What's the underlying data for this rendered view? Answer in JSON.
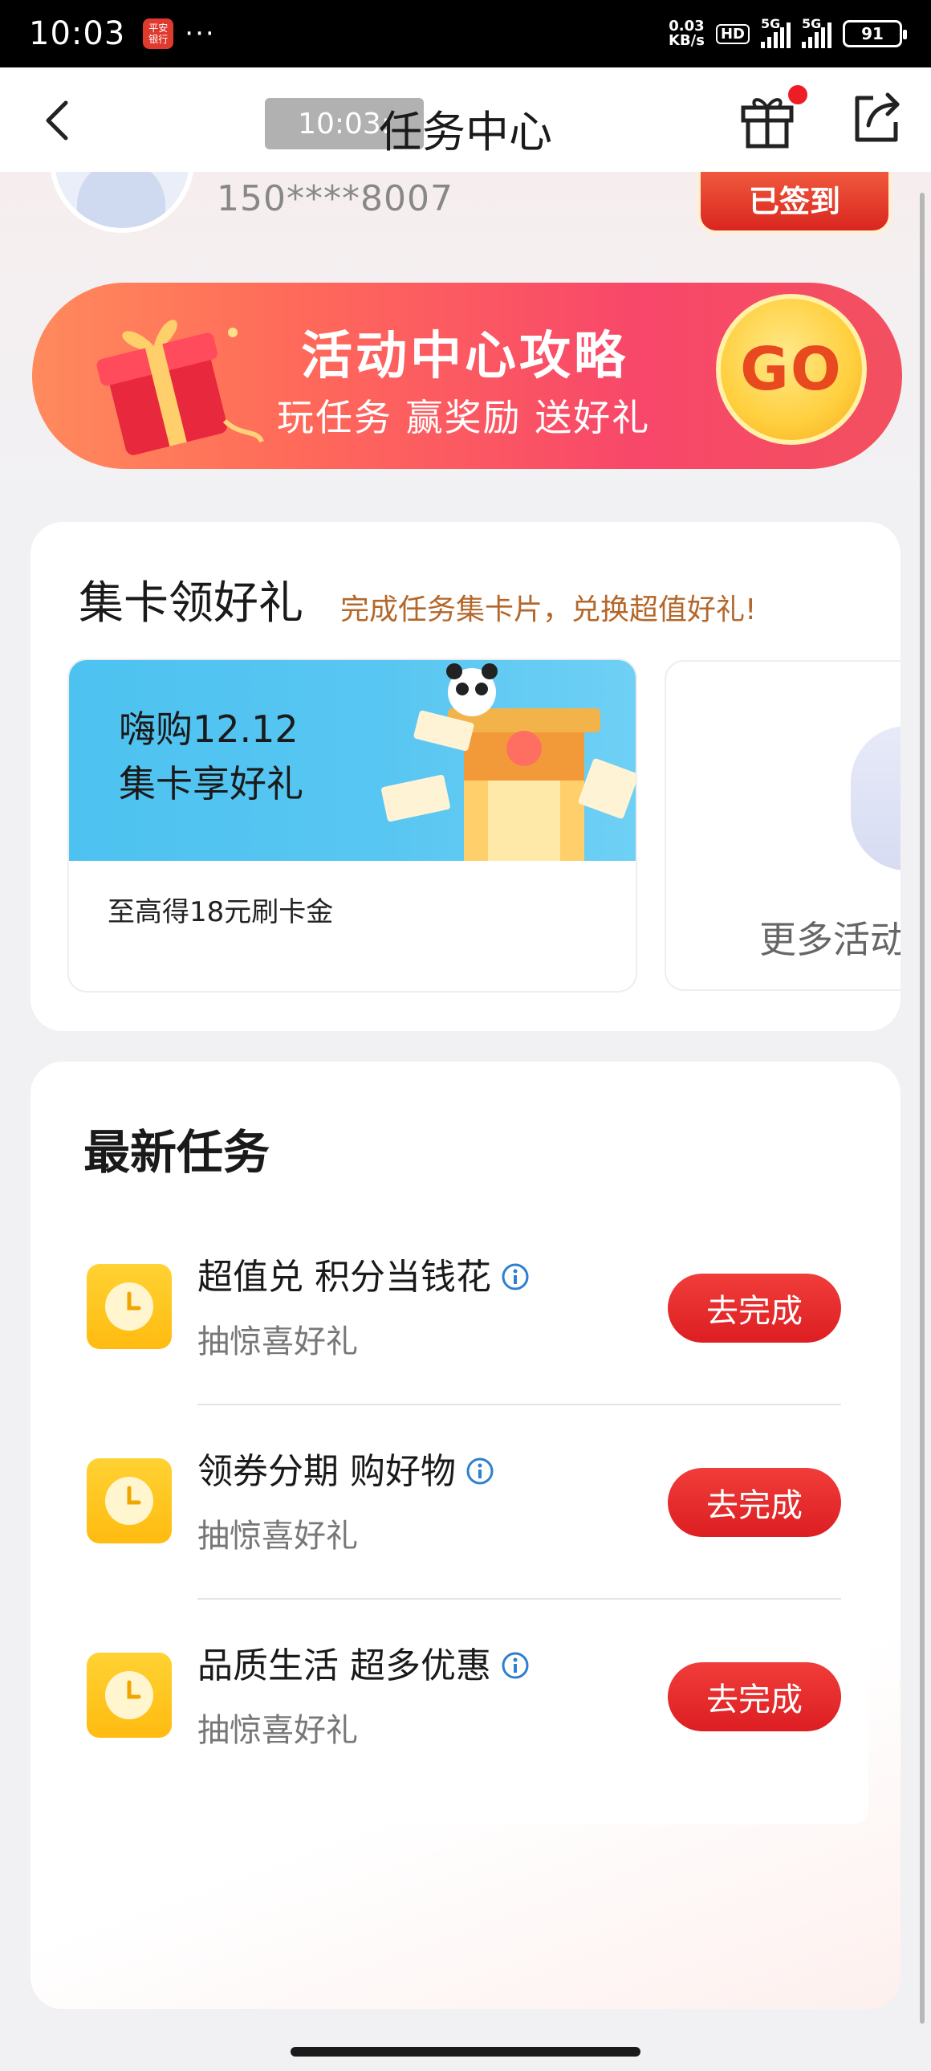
{
  "status_bar": {
    "time": "10:03",
    "app_badge": "平安\n银行",
    "dots": "···",
    "net_speed_value": "0.03",
    "net_speed_unit": "KB/s",
    "hd": "HD",
    "signal1": "5G",
    "signal2": "5G",
    "battery": "91"
  },
  "header": {
    "time_overlay": "10:03:",
    "title": "任务中心"
  },
  "profile": {
    "phone": "150****8007",
    "signed_label": "已签到"
  },
  "banner": {
    "title": "活动中心攻略",
    "subtitle": "玩任务 赢奖励 送好礼",
    "go_label": "GO"
  },
  "collect_cards": {
    "title": "集卡领好礼",
    "subtitle": "完成任务集卡片，兑换超值好礼!",
    "event": {
      "line1": "嗨购12.12",
      "line2": "集卡享好礼",
      "description": "至高得18元刷卡金"
    },
    "more_label": "更多活动"
  },
  "tasks": {
    "heading": "最新任务",
    "items": [
      {
        "title": "超值兑 积分当钱花",
        "subtitle": "抽惊喜好礼",
        "button": "去完成"
      },
      {
        "title": "领券分期 购好物",
        "subtitle": "抽惊喜好礼",
        "button": "去完成"
      },
      {
        "title": "品质生活 超多优惠",
        "subtitle": "抽惊喜好礼",
        "button": "去完成"
      }
    ]
  },
  "colors": {
    "accent_red": "#e8232a",
    "subtitle_brown": "#b4672a",
    "task_icon_yellow": "#ffc81e",
    "info_blue": "#2d7fd0"
  }
}
